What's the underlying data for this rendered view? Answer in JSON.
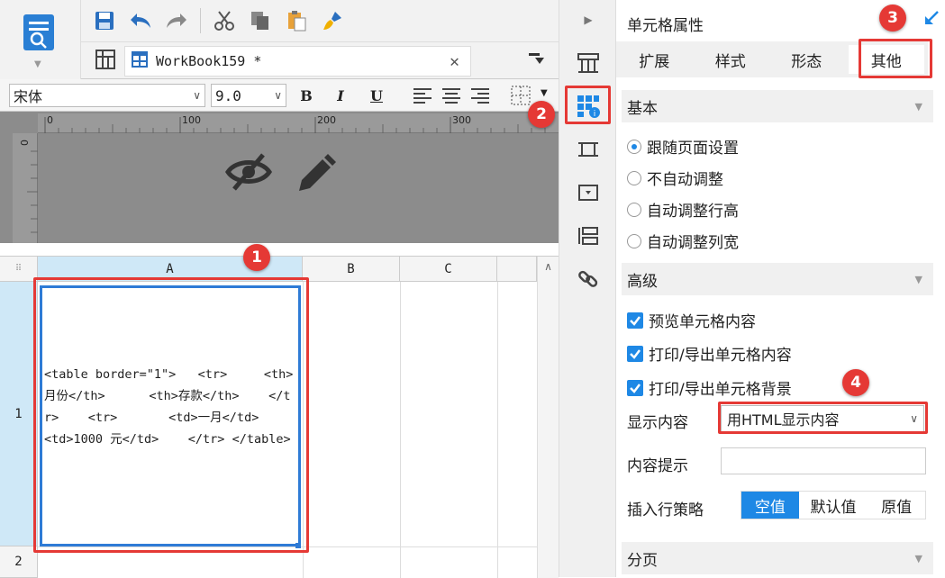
{
  "workbook_tab": {
    "name": "WorkBook159 *"
  },
  "format": {
    "font": "宋体",
    "size": "9.0",
    "bold": "B",
    "italic": "I",
    "underline": "U"
  },
  "ruler": {
    "marks": [
      "0",
      "100",
      "200",
      "300"
    ],
    "vmark": "0"
  },
  "grid": {
    "columns": [
      "A",
      "B",
      "C"
    ],
    "rows": [
      "1",
      "2"
    ],
    "cell_a1": "<table border=\"1\">   <tr>     <th>月份</th>      <th>存款</th>    </tr>    <tr>       <td>一月</td>     <td>1000 元</td>    </tr> </table>"
  },
  "annotations": [
    "1",
    "2",
    "3",
    "4"
  ],
  "panel": {
    "title": "单元格属性",
    "tabs": [
      "扩展",
      "样式",
      "形态",
      "其他"
    ],
    "active_tab": "其他",
    "basic": {
      "title": "基本",
      "options": [
        "跟随页面设置",
        "不自动调整",
        "自动调整行高",
        "自动调整列宽"
      ],
      "selected": "跟随页面设置"
    },
    "advanced": {
      "title": "高级",
      "checks": [
        "预览单元格内容",
        "打印/导出单元格内容",
        "打印/导出单元格背景"
      ],
      "display_label": "显示内容",
      "display_value": "用HTML显示内容",
      "hint_label": "内容提示",
      "hint_value": "",
      "insert_label": "插入行策略",
      "insert_options": [
        "空值",
        "默认值",
        "原值"
      ],
      "insert_selected": "空值"
    },
    "paging": {
      "title": "分页"
    }
  },
  "colors": {
    "accent": "#1e88e5",
    "highlight": "#e53935"
  }
}
